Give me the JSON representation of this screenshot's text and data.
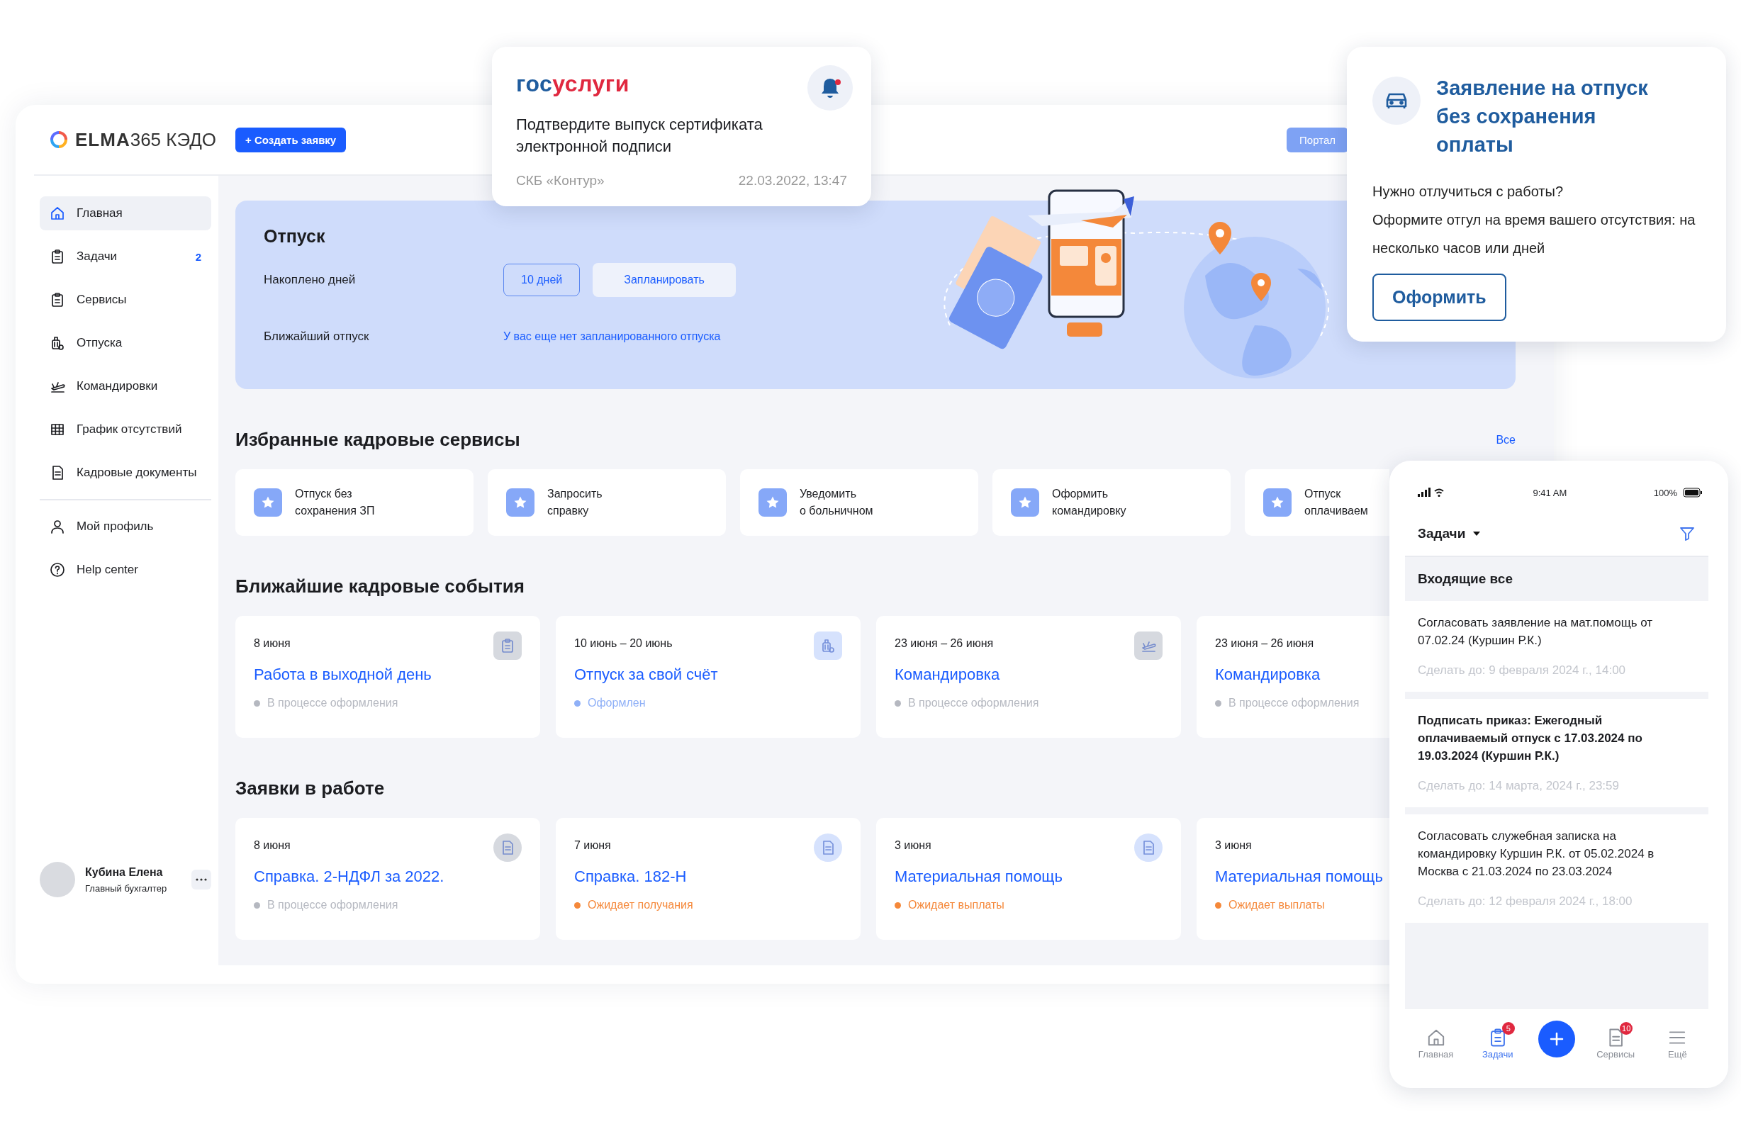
{
  "app": {
    "logo": "**ELMA**365 КЭДО",
    "create_button": "+ Создать заявку",
    "portal_button": "Портал",
    "sidebar": {
      "items": [
        {
          "label": "Главная",
          "selected": true
        },
        {
          "label": "Задачи",
          "selected": false,
          "badge": "2"
        },
        {
          "label": "Сервисы",
          "selected": false
        },
        {
          "label": "Отпуска",
          "selected": false
        },
        {
          "label": "Командировки",
          "selected": false
        },
        {
          "label": "График отсутствий",
          "selected": false
        },
        {
          "label": "Кадровые документы",
          "selected": false
        }
      ],
      "bottom_items": [
        {
          "label": "Мой профиль",
          "selected": false
        },
        {
          "label": "Help center",
          "selected": false
        }
      ],
      "profile": {
        "name": "Кубина Елена",
        "role": "Главный бухгалтер"
      }
    },
    "banner": {
      "title": "Отпуск",
      "accrued": {
        "label": "Накоплено дней",
        "value": "10 дней",
        "button": "Запланировать"
      },
      "nearest": {
        "label": "Ближайший отпуск",
        "value": "У вас еще нет запланированного отпуска"
      }
    },
    "services": {
      "title": "Избранные кадровые сервисы",
      "all_link": "Все",
      "items": [
        {
          "label": "Отпуск без\nсохранения ЗП"
        },
        {
          "label": "Запросить\nсправку"
        },
        {
          "label": "Уведомить\nо больничном"
        },
        {
          "label": "Оформить\nкомандировку"
        },
        {
          "label": "Отпуск\nоплачиваем"
        }
      ]
    },
    "events": {
      "title": "Ближайшие кадровые события",
      "items": [
        {
          "date": "8 июня",
          "title": "Работа в выходной день",
          "status": "В процессе оформления",
          "color": "#b5b8c0",
          "icon": {
            "color": "#d6d9df"
          }
        },
        {
          "date": "10 июнь – 20 июнь",
          "title": "Отпуск за свой счёт",
          "status": "Оформлен",
          "color": "#8fb0f7",
          "icon": {
            "color": "#d6e2fd"
          }
        },
        {
          "date": "23 июня – 26 июня",
          "title": "Командировка",
          "status": "В процессе оформления",
          "color": "#b5b8c0",
          "icon": {
            "color": "#d6d9df"
          }
        },
        {
          "date": "23 июня – 26 июня",
          "title": "Командировка",
          "status": "В процессе оформления",
          "color": "#b5b8c0"
        }
      ]
    },
    "requests": {
      "title": "Заявки в работе",
      "items": [
        {
          "date": "8 июня",
          "title": "Справка. 2-НДФЛ за 2022.",
          "status": "В процессе оформления",
          "color": "#b5b8c0",
          "icon": {
            "color": "#d6d9df"
          }
        },
        {
          "date": "7 июня",
          "title": "Справка. 182-Н",
          "status": "Ожидает получания",
          "color": "#f5883a",
          "icon": {
            "color": "#d6e2fd"
          }
        },
        {
          "date": "3 июня",
          "title": "Материальная помощь",
          "status": "Ожидает выплаты",
          "color": "#f5883a",
          "icon": {
            "color": "#d6e2fd"
          }
        },
        {
          "date": "3 июня",
          "title": "Материальная помощь",
          "status": "Ожидает выплаты",
          "color": "#f5883a"
        }
      ]
    }
  },
  "notification": {
    "logo": {
      "first": "гос",
      "second": "услуги"
    },
    "unread": true,
    "message": "Подтвердите выпуск сертификата электронной подписи",
    "sender": "СКБ «Контур»",
    "time": "22.03.2022, 13:47"
  },
  "promo": {
    "title": "Заявление на отпуск без сохранения оплаты",
    "paragraphs": [
      "Нужно отлучиться с работы?",
      "Оформите отгул на время вашего отсутствия: на несколько часов или дней"
    ],
    "button": "Оформить"
  },
  "mobile": {
    "status_bar": {
      "time": "9:41 AM",
      "battery": "100%"
    },
    "title": "Задачи",
    "section": "Входящие все",
    "tasks": [
      {
        "text": "Согласовать заявление на мат.помощь от 07.02.24 (Куршин Р.К.)",
        "due": "Сделать до: 9 февраля 2024 г., 14:00",
        "unread": false
      },
      {
        "text": "Подписать приказ: Ежегодный оплачиваемый отпуск с 17.03.2024 по 19.03.2024 (Куршин Р.К.)",
        "due": "Сделать до: 14 марта, 2024 г., 23:59",
        "unread": true
      },
      {
        "text": "Согласовать служебная записка на командировку Куршин Р.К. от 05.02.2024 в Москва с 21.03.2024 по 23.03.2024",
        "due": "Сделать до: 12 февраля 2024 г., 18:00",
        "unread": false
      }
    ],
    "tabs": [
      {
        "label": "Главная",
        "selected": false
      },
      {
        "label": "Задачи",
        "selected": true,
        "badge": "5"
      },
      {
        "label": "Сервисы",
        "selected": false,
        "badge": "10"
      },
      {
        "label": "Ещё",
        "selected": false
      }
    ]
  }
}
